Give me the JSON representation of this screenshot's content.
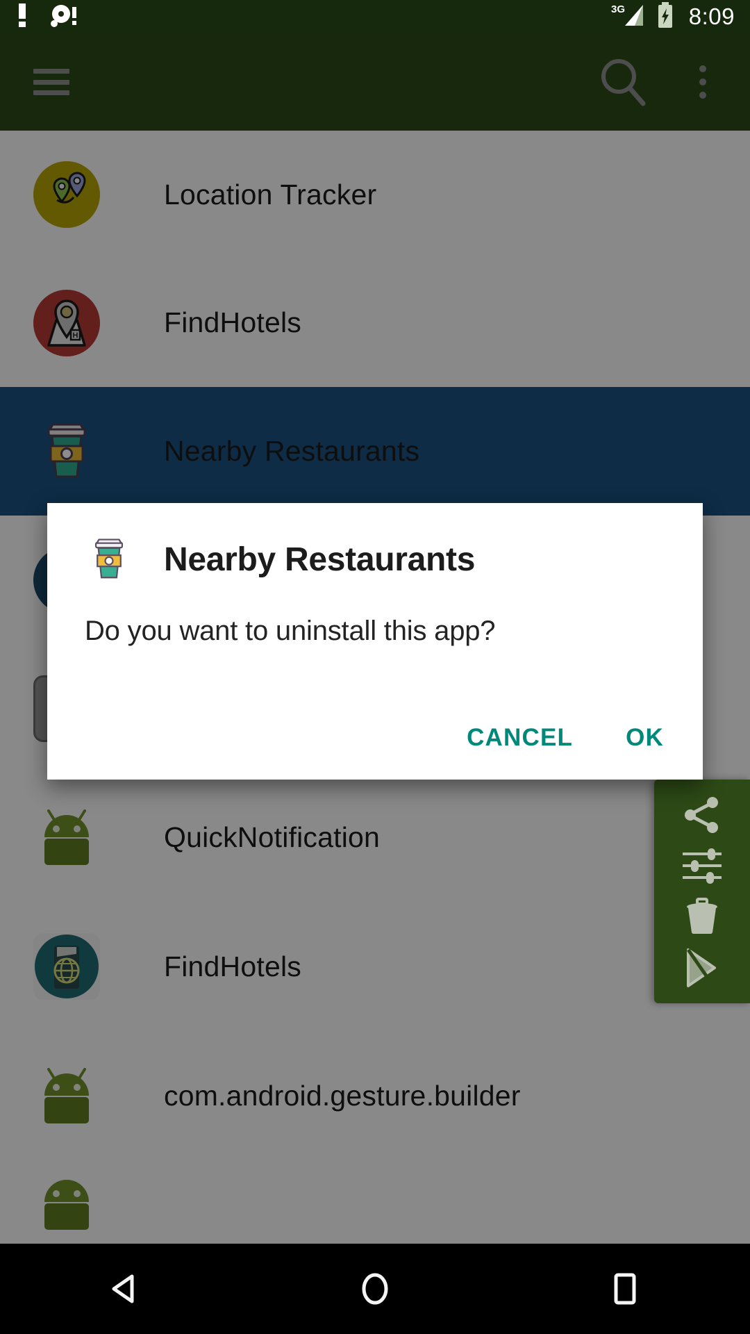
{
  "status_bar": {
    "time": "8:09",
    "network_label": "3G",
    "icons": [
      "warning-icon",
      "disc-alert-icon",
      "signal-3g-icon",
      "battery-charging-icon"
    ],
    "background_color": "#16290c"
  },
  "app_bar": {
    "background_color": "#2d4a16",
    "menu_icon": "hamburger-menu-icon",
    "search_icon": "search-icon",
    "overflow_icon": "more-vertical-icon"
  },
  "app_list": {
    "items": [
      {
        "label": "Location Tracker",
        "icon": "location-tracker-icon",
        "selected": false
      },
      {
        "label": "FindHotels",
        "icon": "findhotels-map-pin-icon",
        "selected": false
      },
      {
        "label": "Nearby Restaurants",
        "icon": "coffee-cup-icon",
        "selected": true
      },
      {
        "label": "",
        "icon": "hidden-icon",
        "selected": false
      },
      {
        "label": "",
        "icon": "hidden-icon",
        "selected": false
      },
      {
        "label": "QuickNotification",
        "icon": "android-robot-icon",
        "selected": false
      },
      {
        "label": "FindHotels",
        "icon": "globe-passport-icon",
        "selected": false
      },
      {
        "label": "com.android.gesture.builder",
        "icon": "android-robot-icon",
        "selected": false
      }
    ],
    "selected_row_color": "#1b5180"
  },
  "side_panel": {
    "background_color": "#2d4a16",
    "actions": [
      {
        "name": "share-icon",
        "label": "Share"
      },
      {
        "name": "settings-sliders-icon",
        "label": "Settings"
      },
      {
        "name": "trash-icon",
        "label": "Delete"
      },
      {
        "name": "play-store-icon",
        "label": "Play Store"
      }
    ]
  },
  "dialog": {
    "title": "Nearby Restaurants",
    "message": "Do you want to uninstall this app?",
    "icon": "coffee-cup-icon",
    "cancel_label": "CANCEL",
    "ok_label": "OK",
    "accent_color": "#00897b",
    "background_color": "#ffffff"
  },
  "nav_bar": {
    "background_color": "#000000",
    "buttons": [
      {
        "name": "back-button",
        "label": "Back"
      },
      {
        "name": "home-button",
        "label": "Home"
      },
      {
        "name": "recents-button",
        "label": "Recents"
      }
    ]
  }
}
